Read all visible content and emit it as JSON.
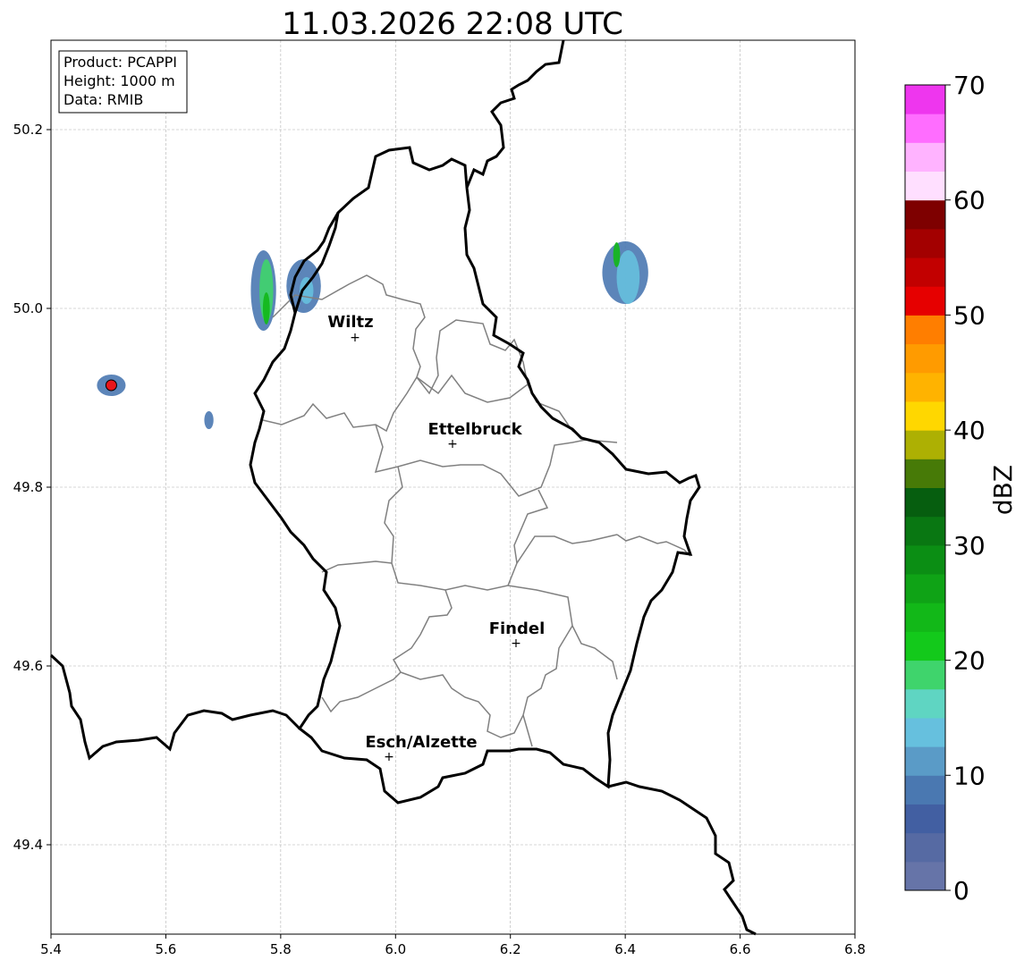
{
  "title": "11.03.2026 22:08 UTC",
  "info_box": {
    "product": "Product: PCAPPI",
    "height": "Height: 1000 m",
    "data": "Data: RMIB"
  },
  "map": {
    "lon_range": [
      5.4,
      6.8
    ],
    "lat_range": [
      49.3,
      50.3
    ],
    "x_ticks": [
      "5.4",
      "5.6",
      "5.8",
      "6.0",
      "6.2",
      "6.4",
      "6.6",
      "6.8"
    ],
    "y_ticks": [
      "49.4",
      "49.6",
      "49.8",
      "50.0",
      "50.2"
    ],
    "gridlines": true,
    "cities": [
      {
        "name": "Wiltz",
        "lon": 5.933,
        "lat": 49.967
      },
      {
        "name": "Ettelbruck",
        "lon": 6.1,
        "lat": 49.849
      },
      {
        "name": "Findel",
        "lon": 6.21,
        "lat": 49.627
      },
      {
        "name": "Esch/Alzette",
        "lon": 5.988,
        "lat": 49.5
      }
    ],
    "radar_site": {
      "lon": 5.505,
      "lat": 49.914,
      "color": "#e8161b"
    },
    "echoes": [
      {
        "lon": 5.77,
        "lat": 50.02,
        "rx": 0.022,
        "ry": 0.045,
        "dbz": 8
      },
      {
        "lon": 5.775,
        "lat": 50.02,
        "rx": 0.012,
        "ry": 0.035,
        "dbz": 18
      },
      {
        "lon": 5.775,
        "lat": 50.0,
        "rx": 0.006,
        "ry": 0.018,
        "dbz": 24
      },
      {
        "lon": 5.84,
        "lat": 50.025,
        "rx": 0.03,
        "ry": 0.03,
        "dbz": 8
      },
      {
        "lon": 5.845,
        "lat": 50.02,
        "rx": 0.012,
        "ry": 0.015,
        "dbz": 14
      },
      {
        "lon": 6.4,
        "lat": 50.04,
        "rx": 0.04,
        "ry": 0.035,
        "dbz": 8
      },
      {
        "lon": 6.405,
        "lat": 50.035,
        "rx": 0.02,
        "ry": 0.03,
        "dbz": 13
      },
      {
        "lon": 6.385,
        "lat": 50.06,
        "rx": 0.006,
        "ry": 0.014,
        "dbz": 24
      },
      {
        "lon": 5.505,
        "lat": 49.914,
        "rx": 0.025,
        "ry": 0.012,
        "dbz": 8
      },
      {
        "lon": 5.675,
        "lat": 49.875,
        "rx": 0.008,
        "ry": 0.01,
        "dbz": 8
      }
    ]
  },
  "colorbar": {
    "label": "dBZ",
    "min": 0,
    "max": 70,
    "tick_values": [
      0,
      10,
      20,
      30,
      40,
      50,
      60,
      70
    ],
    "tick_labels": [
      "0",
      "10",
      "20",
      "30",
      "40",
      "50",
      "60",
      "70"
    ],
    "colors": [
      "#6674a8",
      "#566aa3",
      "#425fa2",
      "#4a78b1",
      "#5a9bc7",
      "#66c0de",
      "#5fd5c2",
      "#3fd46c",
      "#13c91b",
      "#12b818",
      "#0fa316",
      "#0b8e14",
      "#097712",
      "#065e0f",
      "#477a07",
      "#adb003",
      "#ffd700",
      "#ffb300",
      "#ff9b00",
      "#ff7e00",
      "#e60000",
      "#c20000",
      "#a30000",
      "#7e0000",
      "#ffdfff",
      "#ffb3ff",
      "#ff6dff",
      "#ee36ee"
    ]
  }
}
